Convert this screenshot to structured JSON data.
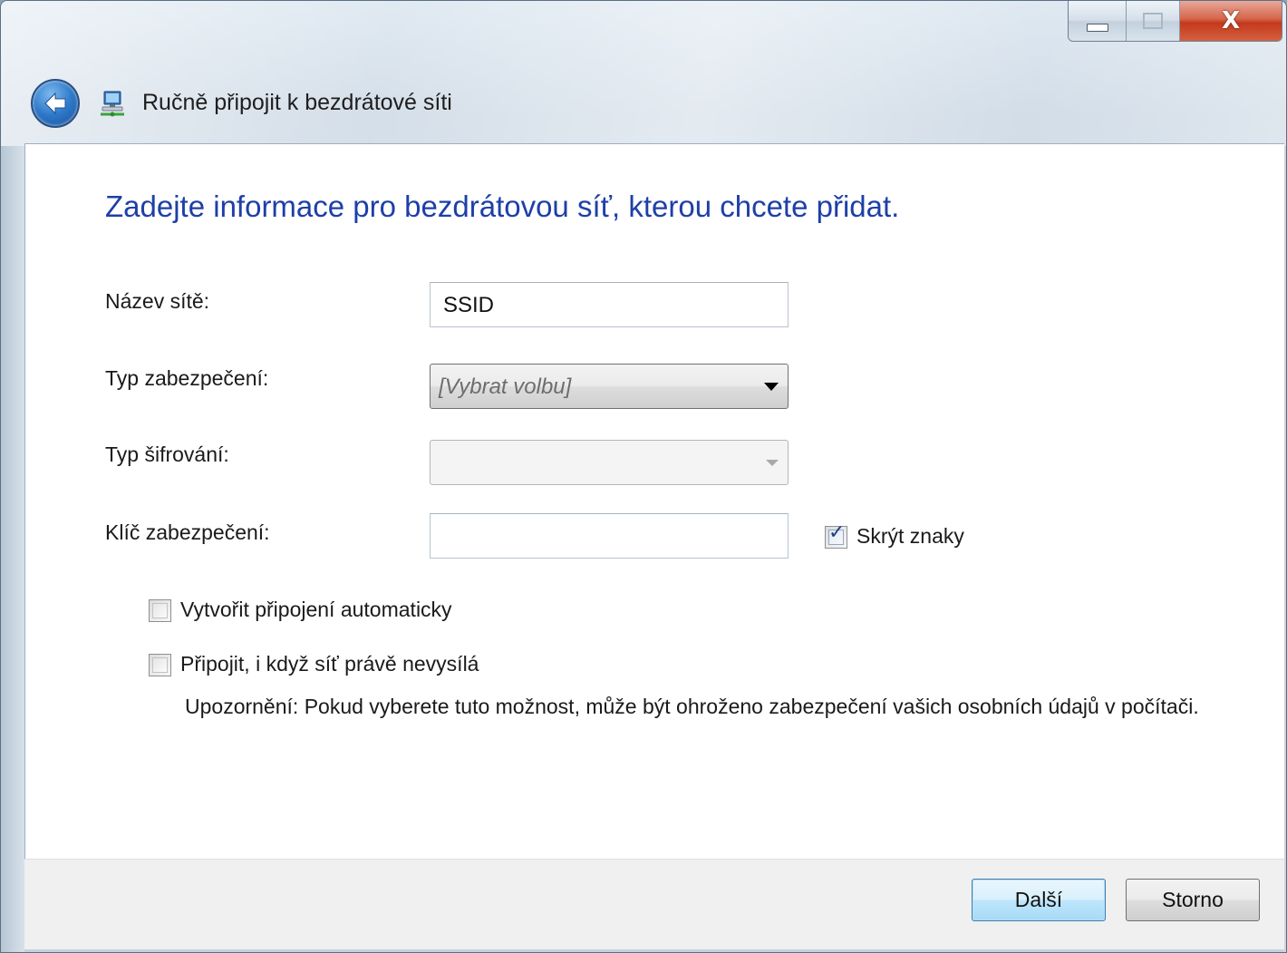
{
  "window": {
    "caption_buttons": {
      "minimize_icon": "minimize-icon",
      "maximize_icon": "maximize-icon",
      "close_label": "X"
    },
    "back_icon": "back-arrow-icon",
    "network_icon": "wireless-network-icon",
    "title": "Ručně připojit k bezdrátové síti"
  },
  "form": {
    "heading": "Zadejte informace pro bezdrátovou síť, kterou chcete přidat.",
    "network_name": {
      "label": "Název sítě:",
      "value": "SSID"
    },
    "security_type": {
      "label": "Typ zabezpečení:",
      "selected": "[Vybrat volbu]"
    },
    "encryption_type": {
      "label": "Typ šifrování:",
      "selected": ""
    },
    "security_key": {
      "label": "Klíč zabezpečení:",
      "value": ""
    },
    "hide_characters": {
      "label": "Skrýt znaky",
      "checked": true
    },
    "auto_connect": {
      "label": "Vytvořit připojení automaticky",
      "checked": false
    },
    "connect_not_broadcasting": {
      "label": "Připojit, i když síť právě nevysílá",
      "checked": false
    },
    "warning": "Upozornění: Pokud vyberete tuto možnost, může být ohroženo zabezpečení vašich osobních údajů v počítači."
  },
  "footer": {
    "next_label": "Další",
    "cancel_label": "Storno"
  },
  "colors": {
    "heading": "#1e3fa8",
    "close_button": "#c3391c",
    "default_button_border": "#3c7fb1"
  }
}
